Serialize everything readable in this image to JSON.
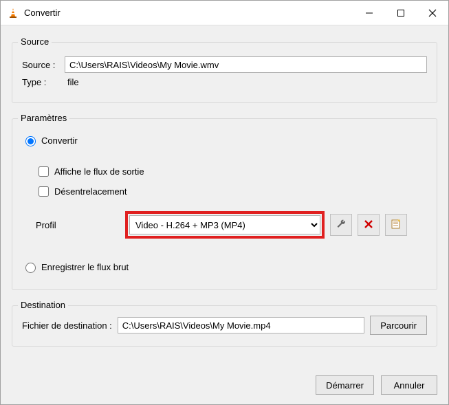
{
  "window": {
    "title": "Convertir"
  },
  "source": {
    "group_title": "Source",
    "source_label": "Source :",
    "source_value": "C:\\Users\\RAIS\\Videos\\My Movie.wmv",
    "type_label": "Type :",
    "type_value": "file"
  },
  "params": {
    "group_title": "Paramètres",
    "convert_label": "Convertir",
    "show_output_label": "Affiche le flux de sortie",
    "deinterlace_label": "Désentrelacement",
    "profile_label": "Profil",
    "profile_value": "Video - H.264 + MP3 (MP4)",
    "dump_raw_label": "Enregistrer le flux brut"
  },
  "destination": {
    "group_title": "Destination",
    "file_label": "Fichier de destination :",
    "file_value": "C:\\Users\\RAIS\\Videos\\My Movie.mp4",
    "browse_label": "Parcourir"
  },
  "footer": {
    "start_label": "Démarrer",
    "cancel_label": "Annuler"
  }
}
